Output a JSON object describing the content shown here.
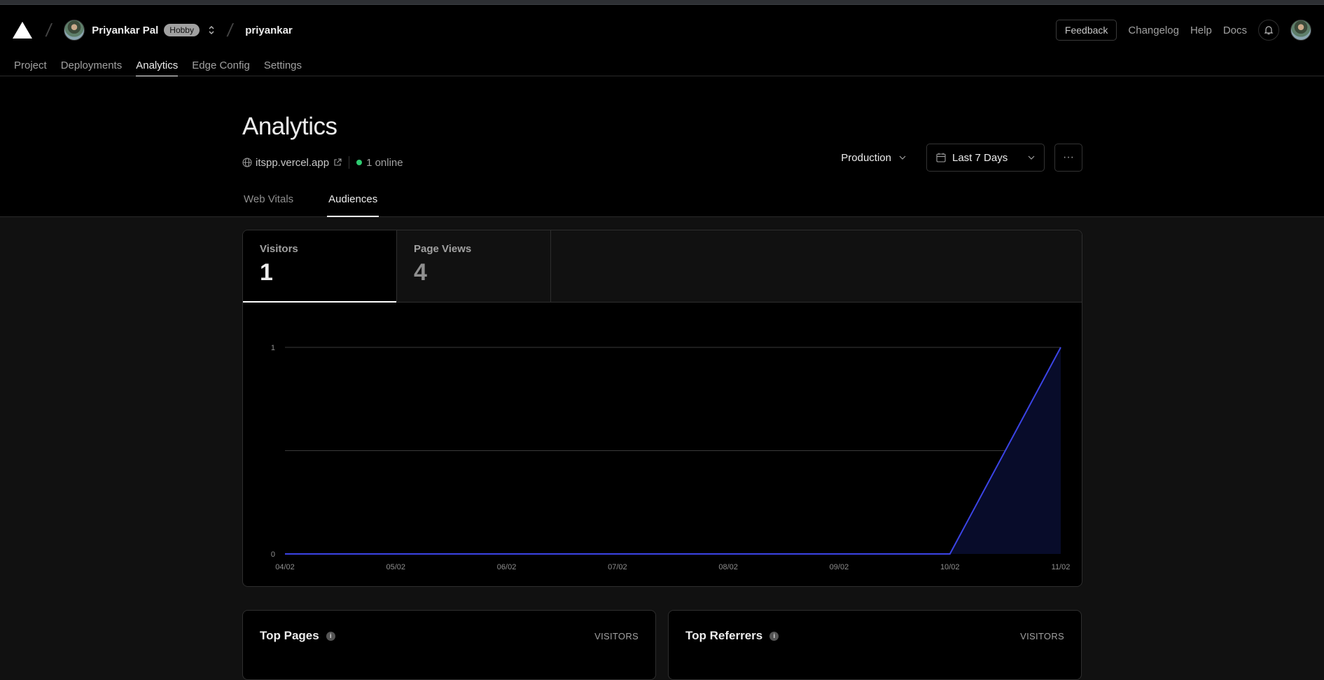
{
  "header": {
    "user_name": "Priyankar Pal",
    "plan_badge": "Hobby",
    "project_name": "priyankar",
    "feedback_label": "Feedback",
    "links": [
      "Changelog",
      "Help",
      "Docs"
    ]
  },
  "nav": {
    "tabs": [
      {
        "label": "Project",
        "active": false
      },
      {
        "label": "Deployments",
        "active": false
      },
      {
        "label": "Analytics",
        "active": true
      },
      {
        "label": "Edge Config",
        "active": false
      },
      {
        "label": "Settings",
        "active": false
      }
    ]
  },
  "page": {
    "title": "Analytics",
    "domain": "itspp.vercel.app",
    "online": "1 online",
    "environment": "Production",
    "date_range": "Last 7 Days",
    "more_label": "···",
    "subtabs": [
      {
        "label": "Web Vitals",
        "active": false
      },
      {
        "label": "Audiences",
        "active": true
      }
    ]
  },
  "metrics": [
    {
      "label": "Visitors",
      "value": "1",
      "active": true
    },
    {
      "label": "Page Views",
      "value": "4",
      "active": false
    }
  ],
  "chart_data": {
    "type": "area",
    "title": "",
    "xlabel": "",
    "ylabel": "",
    "x": [
      "04/02",
      "05/02",
      "06/02",
      "07/02",
      "08/02",
      "09/02",
      "10/02",
      "11/02"
    ],
    "series": [
      {
        "name": "Visitors",
        "values": [
          0,
          0,
          0,
          0,
          0,
          0,
          0,
          1
        ]
      }
    ],
    "yticks": [
      "0",
      "1"
    ],
    "ylim": [
      0,
      1
    ],
    "grid": true,
    "line_color": "#3b44e6",
    "fill_color": "#080c2a"
  },
  "panels": [
    {
      "title": "Top Pages",
      "column": "VISITORS"
    },
    {
      "title": "Top Referrers",
      "column": "VISITORS"
    }
  ]
}
